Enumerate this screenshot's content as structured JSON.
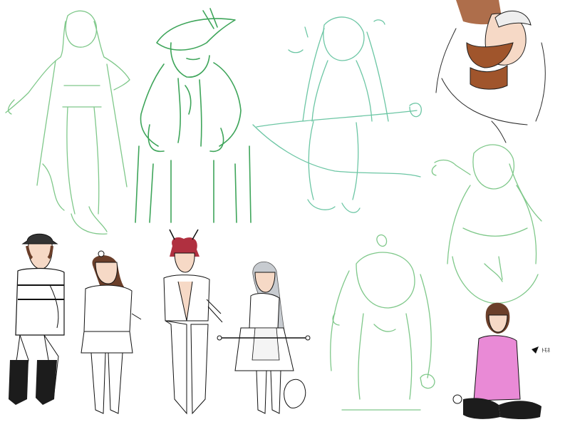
{
  "canvas": {
    "background": "#ffffff"
  },
  "palette": {
    "sketch_green_light": "#7fc88a",
    "sketch_green_dark": "#3ea55a",
    "sketch_teal": "#6cc6a4",
    "ink": "#1e1e1e",
    "skin": "#f6d9c6",
    "skin_dark": "#a0552c",
    "hair_brown": "#6b3f2a",
    "hair_red": "#b03040",
    "hair_silver": "#c7cbd0",
    "shirt_pink": "#e98ad6",
    "stocking_black": "#1c1c1c"
  },
  "figures": [
    {
      "id": "sketch-coat-figure",
      "style": "green sketch"
    },
    {
      "id": "sketch-hat-figure",
      "style": "green sketch"
    },
    {
      "id": "sketch-cape-figure",
      "style": "teal sketch"
    },
    {
      "id": "colored-hug-couple",
      "style": "partially colored"
    },
    {
      "id": "sketch-wrench-girl",
      "style": "green sketch"
    },
    {
      "id": "lineart-hat-boy",
      "style": "colored lineart"
    },
    {
      "id": "lineart-bow-girl",
      "style": "colored lineart"
    },
    {
      "id": "lineart-horned-boy",
      "style": "colored lineart"
    },
    {
      "id": "lineart-maid-girl",
      "style": "colored lineart"
    },
    {
      "id": "sketch-spirit-girl",
      "style": "green sketch"
    },
    {
      "id": "colored-pink-shirt-girl",
      "style": "colored"
    }
  ],
  "annotations": {
    "small_note": "ﾄﾓﾈ"
  }
}
